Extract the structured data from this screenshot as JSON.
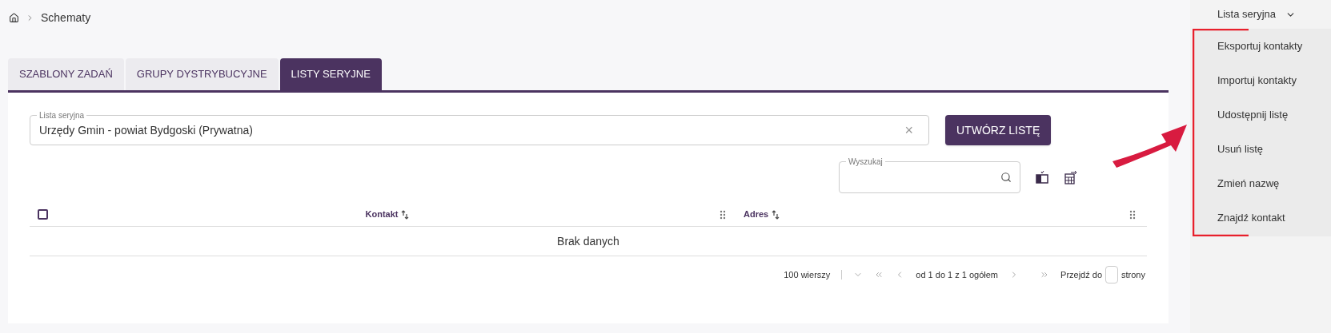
{
  "breadcrumb": {
    "items": [
      "Schematy"
    ]
  },
  "tabs": [
    {
      "label": "SZABLONY ZADAŃ",
      "selected": false
    },
    {
      "label": "GRUPY DYSTRYBUCYJNE",
      "selected": false
    },
    {
      "label": "LISTY SERYJNE",
      "selected": true
    }
  ],
  "list_field": {
    "label": "Lista seryjna",
    "value": "Urzędy Gmin - powiat Bydgoski (Prywatna)",
    "clear": "×"
  },
  "create_button": "UTWÓRZ LISTĘ",
  "search": {
    "label": "Wyszukaj"
  },
  "table": {
    "select_all": {
      "checked": false
    },
    "columns": [
      "Kontakt",
      "Adres"
    ],
    "empty": "Brak danych"
  },
  "pagination": {
    "rows_per_page": "100 wierszy",
    "range": "od 1 do 1 z 1 ogółem",
    "goto_label": "Przejdź do",
    "pages_label": "strony"
  },
  "side_menu": {
    "title": "Lista seryjna",
    "items": [
      "Eksportuj kontakty",
      "Importuj kontakty",
      "Udostępnij listę",
      "Usuń listę",
      "Zmień nazwę",
      "Znajdź kontakt"
    ]
  }
}
